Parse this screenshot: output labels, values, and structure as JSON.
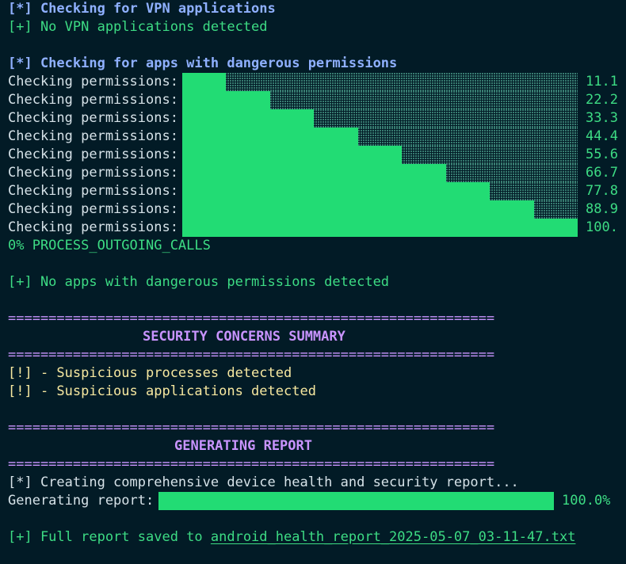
{
  "vpn": {
    "checking": "[*] Checking for VPN applications",
    "result": "[+] No VPN applications detected"
  },
  "permissions": {
    "checking": "[*] Checking for apps with dangerous permissions",
    "row_label": "Checking permissions:",
    "rows": [
      {
        "progress": 11.1,
        "pct": "11.1"
      },
      {
        "progress": 22.2,
        "pct": "22.2"
      },
      {
        "progress": 33.3,
        "pct": "33.3"
      },
      {
        "progress": 44.4,
        "pct": "44.4"
      },
      {
        "progress": 55.6,
        "pct": "55.6"
      },
      {
        "progress": 66.7,
        "pct": "66.7"
      },
      {
        "progress": 77.8,
        "pct": "77.8"
      },
      {
        "progress": 88.9,
        "pct": "88.9"
      },
      {
        "progress": 100.0,
        "pct": "100."
      }
    ],
    "overflow": "0% PROCESS_OUTGOING_CALLS",
    "result": "[+] No apps with dangerous permissions detected"
  },
  "summary": {
    "rule": "============================================================",
    "title": "SECURITY CONCERNS SUMMARY",
    "items": [
      "[!] - Suspicious processes detected",
      "[!] - Suspicious applications detected"
    ]
  },
  "report": {
    "rule": "============================================================",
    "title": "GENERATING REPORT",
    "creating": "[*] Creating comprehensive device health and security report...",
    "label": "Generating report:",
    "progress": 100.0,
    "pct": "100.0%",
    "saved_prefix": "[+] Full report saved to ",
    "filename": "android_health_report_2025-05-07_03-11-47.txt"
  },
  "colors": {
    "background": "#021b26",
    "bar_fill": "#22dc74",
    "success": "#3ddc84",
    "info": "#8fb0ff",
    "warning": "#f7e8a0",
    "heading": "#c994ff"
  }
}
